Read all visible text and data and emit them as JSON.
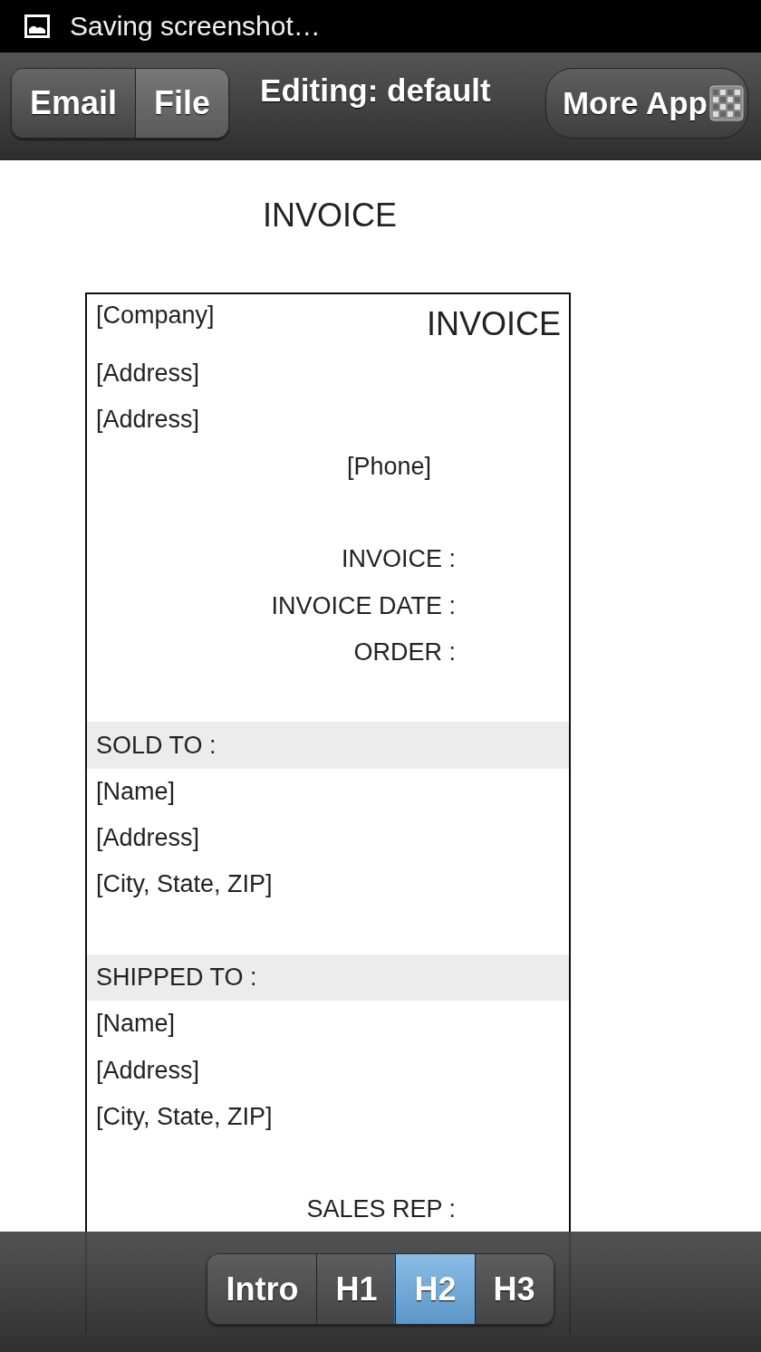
{
  "status_bar": {
    "text": "Saving screenshot…"
  },
  "toolbar": {
    "tabs": [
      {
        "label": "Email",
        "selected": false
      },
      {
        "label": "File",
        "selected": true
      }
    ],
    "title": "Editing: default",
    "more_button": "More App"
  },
  "page_title": "INVOICE",
  "document": {
    "company": "[Company]",
    "heading": "INVOICE",
    "rows": [
      {
        "kind": "left",
        "text": "[Address]"
      },
      {
        "kind": "left",
        "text": "[Address]"
      },
      {
        "kind": "phone",
        "text": "[Phone]"
      },
      {
        "kind": "spacer"
      },
      {
        "kind": "label",
        "text": "INVOICE :"
      },
      {
        "kind": "label",
        "text": "INVOICE DATE :"
      },
      {
        "kind": "label",
        "text": "ORDER :"
      },
      {
        "kind": "spacer"
      },
      {
        "kind": "section",
        "text": "SOLD TO :"
      },
      {
        "kind": "left",
        "text": "[Name]"
      },
      {
        "kind": "left",
        "text": "[Address]"
      },
      {
        "kind": "left",
        "text": "[City, State, ZIP]"
      },
      {
        "kind": "spacer"
      },
      {
        "kind": "section",
        "text": "SHIPPED TO :"
      },
      {
        "kind": "left",
        "text": "[Name]"
      },
      {
        "kind": "left",
        "text": "[Address]"
      },
      {
        "kind": "left",
        "text": "[City, State, ZIP]"
      },
      {
        "kind": "spacer"
      },
      {
        "kind": "label",
        "text": "SALES REP :"
      }
    ]
  },
  "bottom_tabs": [
    {
      "label": "Intro",
      "selected": false
    },
    {
      "label": "H1",
      "selected": false
    },
    {
      "label": "H2",
      "selected": true
    },
    {
      "label": "H3",
      "selected": false
    }
  ]
}
